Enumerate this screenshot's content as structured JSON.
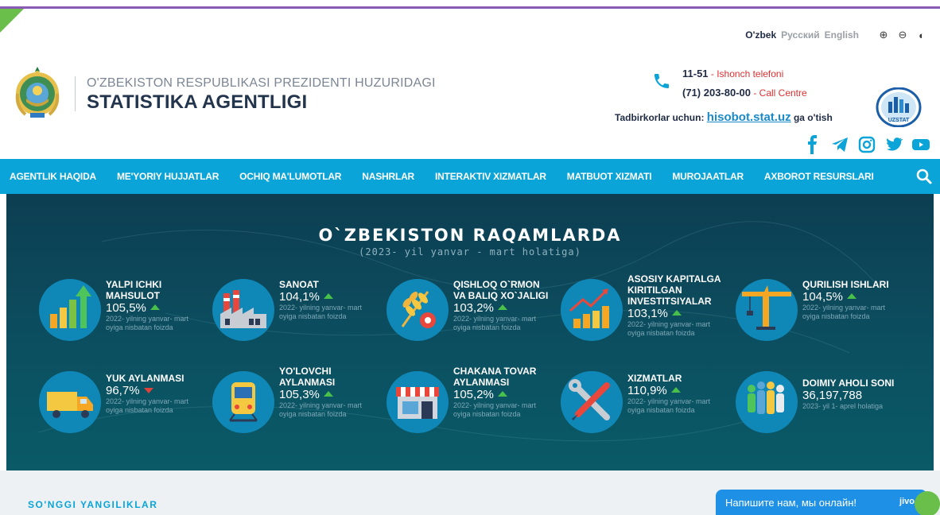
{
  "languages": [
    "O'zbek",
    "Русский",
    "English"
  ],
  "accessibility": {
    "zoom_in": "⊕",
    "zoom_out": "⊖",
    "contrast": "◐"
  },
  "header": {
    "org_top": "O'ZBEKISTON RESPUBLIKASI PREZIDENTI HUZURIDAGI",
    "org_main": "STATISTIKA AGENTLIGI"
  },
  "contacts": {
    "trust_number": "11-51",
    "trust_label": " - Ishonch telefoni",
    "call_number": "(71) 203-80-00",
    "call_label": " - Call Centre",
    "biz_prefix": "Tadbirkorlar uchun: ",
    "biz_link": "hisobot.stat.uz",
    "biz_suffix": " ga o'tish"
  },
  "logo_text": "UZSTAT",
  "nav": [
    "AGENTLIK HAQIDA",
    "ME'YORIY HUJJATLAR",
    "OCHIQ MA'LUMOTLAR",
    "NASHRLAR",
    "INTERAKTIV XIZMATLAR",
    "MATBUOT XIZMATI",
    "MUROJAATLAR",
    "AXBOROT RESURSLARI"
  ],
  "stats": {
    "title": "O`ZBEKISTON RAQAMLARDA",
    "subtitle": "(2023- yil yanvar - mart holatiga)",
    "items": [
      {
        "title": "YALPI ICHKI MAHSULOT",
        "value": "105,5%",
        "trend": "up",
        "note": "2022- yilning yanvar- mart oyiga nisbatan foizda"
      },
      {
        "title": "SANOAT",
        "value": "104,1%",
        "trend": "up",
        "note": "2022- yilning yanvar- mart oyiga nisbatan foizda"
      },
      {
        "title": "QISHLOQ O`RMON VA BALIQ XO`JALIGI",
        "value": "103,2%",
        "trend": "up",
        "note": "2022- yilning yanvar- mart oyiga nisbatan foizda"
      },
      {
        "title": "ASOSIY KAPITALGA KIRITILGAN INVESTITSIYALAR",
        "value": "103,1%",
        "trend": "up",
        "note": "2022- yilning yanvar- mart oyiga nisbatan foizda"
      },
      {
        "title": "QURILISH ISHLARI",
        "value": "104,5%",
        "trend": "up",
        "note": "2022- yilning yanvar- mart oyiga nisbatan foizda"
      },
      {
        "title": "YUK AYLANMASI",
        "value": "96,7%",
        "trend": "down",
        "note": "2022- yilning yanvar- mart oyiga nisbatan foizda"
      },
      {
        "title": "YO'LOVCHI AYLANMASI",
        "value": "105,3%",
        "trend": "up",
        "note": "2022- yilning yanvar- mart oyiga nisbatan foizda"
      },
      {
        "title": "CHAKANA TOVAR AYLANMASI",
        "value": "105,2%",
        "trend": "up",
        "note": "2022- yilning yanvar- mart oyiga nisbatan foizda"
      },
      {
        "title": "XIZMATLAR",
        "value": "110,9%",
        "trend": "up",
        "note": "2022- yilning yanvar- mart oyiga nisbatan foizda"
      },
      {
        "title": "DOIMIY AHOLI SONI",
        "value": "36,197,788",
        "trend": "none",
        "note": "2023- yil 1- aprel holatiga"
      }
    ]
  },
  "news_heading": "SO'NGGI YANGILIKLAR",
  "chat": {
    "text": "Напишите нам, мы онлайн!",
    "brand": "jivo"
  },
  "icons": [
    "phone-icon",
    "search-icon",
    "facebook-icon",
    "telegram-icon",
    "instagram-icon",
    "twitter-icon",
    "youtube-icon"
  ],
  "colors": {
    "nav": "#0aa4d8",
    "accent_red": "#e03131",
    "up": "#49c04a",
    "down": "#e0413a"
  }
}
